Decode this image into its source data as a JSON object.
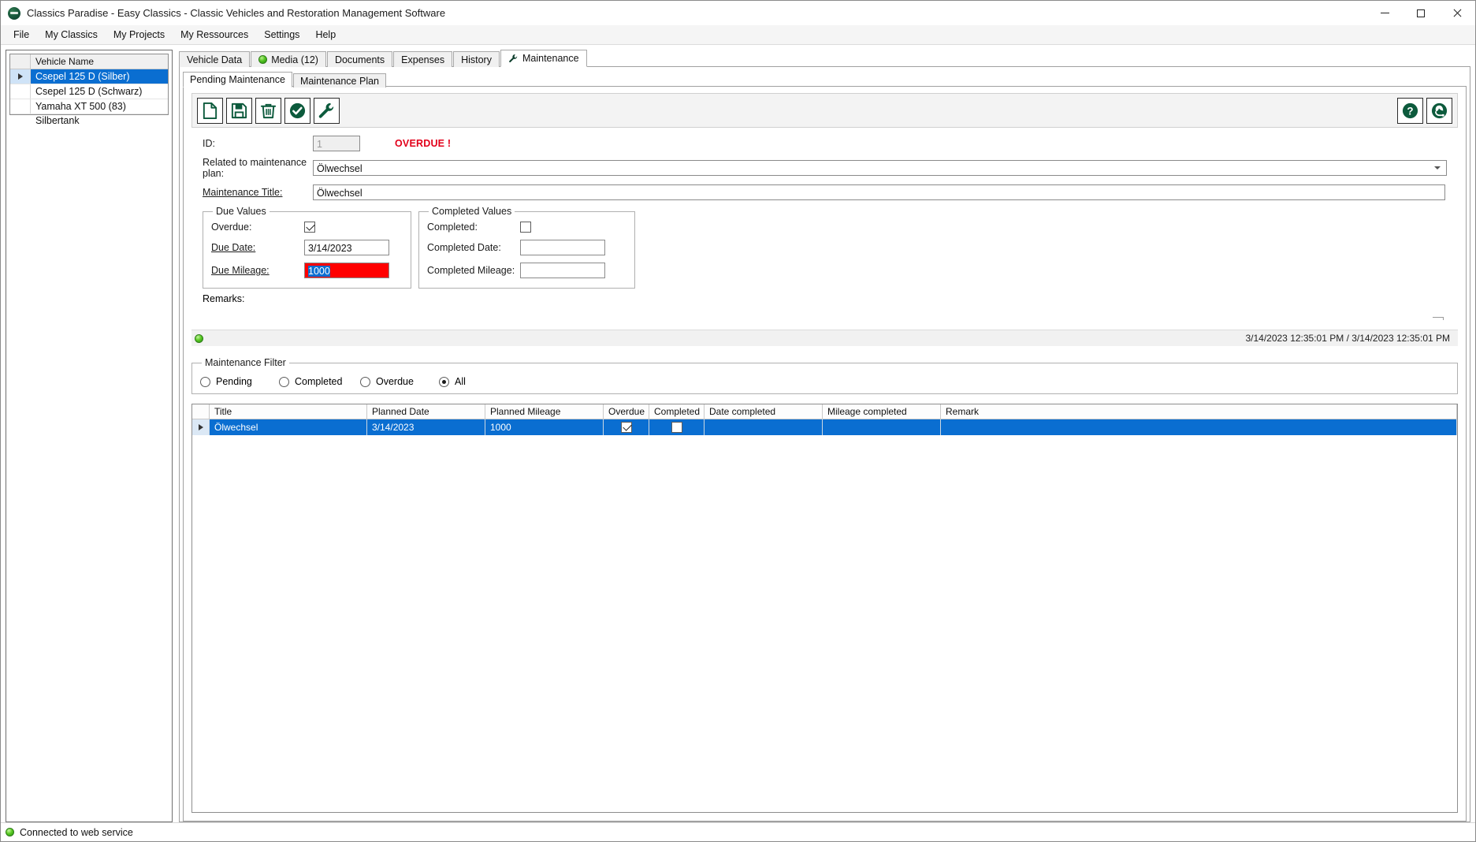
{
  "window": {
    "title": "Classics Paradise - Easy Classics - Classic Vehicles and Restoration Management Software",
    "logo_color": "#16543a",
    "minimize_label": "—",
    "maximize_label": "□",
    "close_label": "×"
  },
  "menubar": {
    "items": [
      {
        "label": "File"
      },
      {
        "label": "My Classics"
      },
      {
        "label": "My Projects"
      },
      {
        "label": "My Ressources"
      },
      {
        "label": "Settings"
      },
      {
        "label": "Help"
      }
    ]
  },
  "vehicle_list": {
    "column_header": "Vehicle Name",
    "rows": [
      {
        "name": "Csepel 125 D (Silber)",
        "selected": true
      },
      {
        "name": "Csepel 125 D (Schwarz)",
        "selected": false
      },
      {
        "name": "Yamaha XT 500 (83) Silbertank",
        "selected": false
      }
    ]
  },
  "main_tabs": [
    {
      "label": "Vehicle Data",
      "icon": "",
      "active": false
    },
    {
      "label": "Media (12)",
      "icon": "green-dot-icon",
      "active": false
    },
    {
      "label": "Documents",
      "icon": "",
      "active": false
    },
    {
      "label": "Expenses",
      "icon": "",
      "active": false
    },
    {
      "label": "History",
      "icon": "",
      "active": false
    },
    {
      "label": "Maintenance",
      "icon": "wrench-icon",
      "active": true
    }
  ],
  "sub_tabs": [
    {
      "label": "Pending Maintenance",
      "active": true
    },
    {
      "label": "Maintenance Plan",
      "active": false
    }
  ],
  "toolbar": {
    "left": [
      {
        "name": "new-record-button",
        "icon": "new-document-icon"
      },
      {
        "name": "save-record-button",
        "icon": "floppy-save-icon"
      },
      {
        "name": "delete-record-button",
        "icon": "trash-icon"
      },
      {
        "name": "mark-completed-button",
        "icon": "check-circle-icon"
      },
      {
        "name": "maintenance-tool-button",
        "icon": "wrench-icon"
      }
    ],
    "right": [
      {
        "name": "help-button",
        "icon": "question-circle-icon"
      },
      {
        "name": "support-button",
        "icon": "support-agent-icon"
      }
    ]
  },
  "form": {
    "id_label": "ID:",
    "id_value": "1",
    "overdue_banner": "OVERDUE !",
    "plan_label": "Related to maintenance plan:",
    "plan_value": "Ölwechsel",
    "title_label": "Maintenance Title:",
    "title_value": "Ölwechsel",
    "due_values": {
      "legend": "Due Values",
      "overdue_label": "Overdue:",
      "overdue_checked": true,
      "due_date_label": "Due Date:",
      "due_date_value": "3/14/2023",
      "due_mileage_label": "Due Mileage:",
      "due_mileage_value": "1000",
      "due_mileage_bg": "#ff0000"
    },
    "completed_values": {
      "legend": "Completed Values",
      "completed_label": "Completed:",
      "completed_checked": false,
      "completed_date_label": "Completed Date:",
      "completed_date_value": "",
      "completed_mileage_label": "Completed Mileage:",
      "completed_mileage_value": ""
    },
    "remarks_label": "Remarks:",
    "remarks_value": "",
    "record_timestamps": "3/14/2023 12:35:01 PM / 3/14/2023 12:35:01 PM"
  },
  "filter": {
    "legend": "Maintenance Filter",
    "options": [
      {
        "label": "Pending",
        "selected": false
      },
      {
        "label": "Completed",
        "selected": false
      },
      {
        "label": "Overdue",
        "selected": false
      },
      {
        "label": "All",
        "selected": true
      }
    ]
  },
  "grid": {
    "columns": [
      "Title",
      "Planned Date",
      "Planned Mileage",
      "Overdue",
      "Completed",
      "Date completed",
      "Mileage completed",
      "Remark"
    ],
    "rows": [
      {
        "selected": true,
        "title": "Ölwechsel",
        "planned_date": "3/14/2023",
        "planned_mileage": "1000",
        "overdue": true,
        "completed": false,
        "date_completed": "",
        "mileage_completed": "",
        "remark": ""
      }
    ]
  },
  "statusbar": {
    "text": "Connected to web service",
    "led_color": "#4caf28"
  }
}
